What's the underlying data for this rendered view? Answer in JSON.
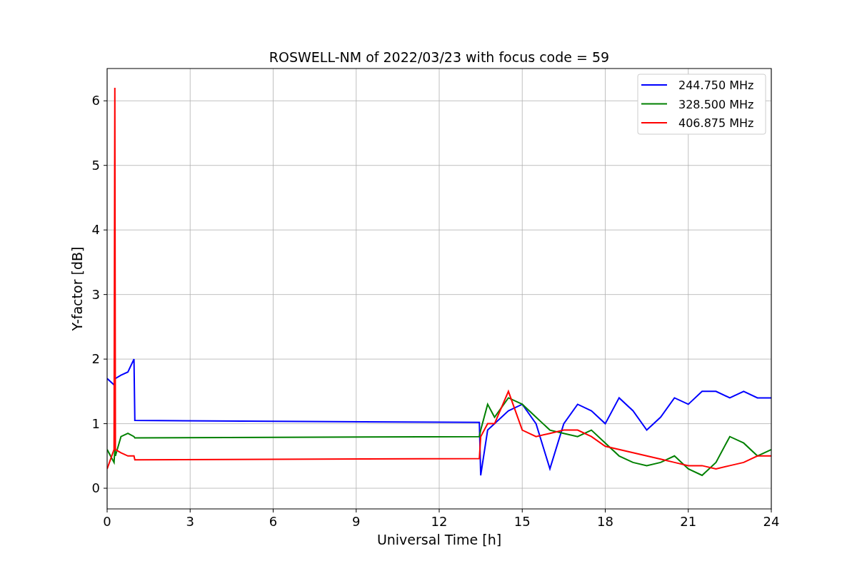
{
  "chart_data": {
    "type": "line",
    "title": "ROSWELL-NM of 2022/03/23 with focus code = 59",
    "xlabel": "Universal Time [h]",
    "ylabel": "Y-factor [dB]",
    "x": [
      0,
      0.25,
      0.28,
      0.3,
      0.5,
      0.75,
      0.97,
      1.0,
      13.45,
      13.5,
      13.75,
      14,
      14.5,
      15,
      15.5,
      16,
      16.5,
      17,
      17.5,
      18,
      18.5,
      19,
      19.5,
      20,
      20.5,
      21,
      21.5,
      22,
      22.5,
      23,
      23.5,
      24
    ],
    "series": [
      {
        "name": "244.750 MHz",
        "color": "#0000ff",
        "values": [
          1.7,
          1.6,
          1.7,
          1.7,
          1.75,
          1.8,
          2.0,
          1.05,
          1.02,
          0.2,
          0.9,
          1.0,
          1.2,
          1.3,
          1.0,
          0.3,
          1.0,
          1.3,
          1.2,
          1.0,
          1.4,
          1.2,
          0.9,
          1.1,
          1.4,
          1.3,
          1.5,
          1.5,
          1.4,
          1.5,
          1.4,
          1.4
        ]
      },
      {
        "name": "328.500 MHz",
        "color": "#008000",
        "values": [
          0.6,
          0.4,
          0.6,
          0.5,
          0.8,
          0.85,
          0.8,
          0.78,
          0.8,
          0.9,
          1.3,
          1.1,
          1.4,
          1.3,
          1.1,
          0.9,
          0.85,
          0.8,
          0.9,
          0.7,
          0.5,
          0.4,
          0.35,
          0.4,
          0.5,
          0.3,
          0.2,
          0.4,
          0.8,
          0.7,
          0.5,
          0.6
        ]
      },
      {
        "name": "406.875 MHz",
        "color": "#ff0000",
        "values": [
          0.3,
          0.6,
          6.2,
          0.6,
          0.55,
          0.5,
          0.5,
          0.44,
          0.46,
          0.8,
          1.0,
          1.0,
          1.5,
          0.9,
          0.8,
          0.85,
          0.9,
          0.9,
          0.8,
          0.65,
          0.6,
          0.55,
          0.5,
          0.45,
          0.4,
          0.35,
          0.35,
          0.3,
          0.35,
          0.4,
          0.5,
          0.5
        ]
      }
    ],
    "grid": true,
    "legend": "upper right",
    "xlim": [
      0,
      24
    ],
    "ylim": [
      -0.32,
      6.5
    ],
    "xticks": [
      0,
      3,
      6,
      9,
      12,
      15,
      18,
      21,
      24
    ],
    "yticks": [
      0,
      1,
      2,
      3,
      4,
      5,
      6
    ]
  }
}
